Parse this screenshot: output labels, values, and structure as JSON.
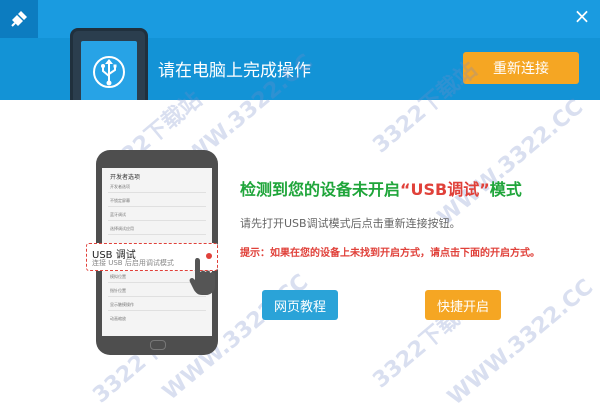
{
  "header": {
    "title": "请在电脑上完成操作",
    "reconnect_label": "重新连接",
    "close_glyph": "×"
  },
  "phone": {
    "screen_title": "开发者选项",
    "menu_items": [
      "开发者选项",
      "不锁定屏幕",
      "蓝牙调试",
      "选择调试应用",
      "模拟位置",
      "指针位置",
      "显示触摸操作",
      "动画缩放"
    ],
    "usb_card": {
      "title": "USB 调试",
      "subtitle": "连接 USB 后启用调试模式"
    }
  },
  "main": {
    "title_prefix": "检测到您的设备未开启",
    "title_highlight": "“USB调试”",
    "title_suffix": "模式",
    "description": "请先打开USB调试模式后点击重新连接按钮。",
    "tip": "提示：如果在您的设备上未找到开启方式，请点击下面的开启方式。",
    "web_tutorial_label": "网页教程",
    "quick_enable_label": "快捷开启"
  },
  "watermark": {
    "text": "3322下载站",
    "url": "WWW.3322.CC"
  },
  "colors": {
    "header_bg": "#1393d6",
    "accent_orange": "#f5a623",
    "title_green": "#1fa53a",
    "alert_red": "#e0413a",
    "button_blue": "#2aa3d8"
  },
  "icons": {
    "app": "usb-plug-icon",
    "hero": "usb-icon",
    "close": "close-icon",
    "hand": "pointing-hand-icon"
  }
}
